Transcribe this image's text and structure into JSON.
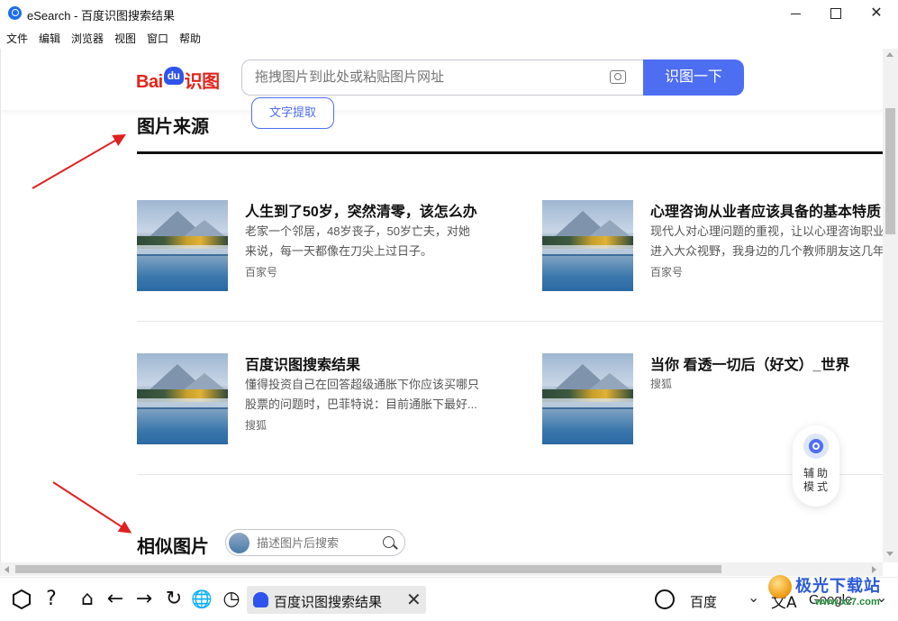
{
  "window": {
    "title": "eSearch - 百度识图搜索结果",
    "minimize": "",
    "maximize": "",
    "close": "✕"
  },
  "menu": [
    "文件",
    "编辑",
    "浏览器",
    "视图",
    "窗口",
    "帮助"
  ],
  "header": {
    "logo_bai": "Bai",
    "logo_du": "du",
    "logo_shi": "识图",
    "search_placeholder": "拖拽图片到此处或粘贴图片网址",
    "search_button": "识图一下",
    "text_extract": "文字提取"
  },
  "sections": {
    "image_source": "图片来源",
    "similar_images": "相似图片"
  },
  "results": [
    {
      "title": "人生到了50岁，突然清零，该怎么办",
      "desc1": "老家一个邻居，48岁丧子，50岁亡夫，对她",
      "desc2": "来说，每一天都像在刀尖上过日子。",
      "source": "百家号"
    },
    {
      "title": "心理咨询从业者应该具备的基本特质",
      "desc1": "现代人对心理问题的重视，让以心理咨询职业",
      "desc2": "进入大众视野，我身边的几个教师朋友这几年",
      "source": "百家号"
    },
    {
      "title": "百度识图搜索结果",
      "desc1": "懂得投资自己在回答超级通胀下你应该买哪只",
      "desc2": "股票的问题时，巴菲特说：目前通胀下最好...",
      "source": "搜狐"
    },
    {
      "title": "当你 看透一切后（好文）_世界",
      "source": "搜狐"
    }
  ],
  "assist": {
    "label": "辅助模式"
  },
  "similar_search": {
    "placeholder": "描述图片后搜索"
  },
  "toolbar": {
    "help_icon": "?",
    "home_icon": "⌂",
    "back_icon": "←",
    "forward_icon": "→",
    "reload_icon": "↻",
    "globe_icon": "🌐",
    "history_icon": "◷",
    "tab_title": "百度识图搜索结果",
    "tab_close": "✕",
    "search_engine": "百度",
    "engine_chevron": "⌄",
    "translate_icon": "文A",
    "translate_engine": "Google",
    "translate_chevron": "⌄"
  },
  "watermark": {
    "text": "极光下载站",
    "url": "www.xz7.com"
  },
  "colors": {
    "accent": "#4e6ef2",
    "baidu_red": "#e1251b",
    "baidu_blue": "#2f54eb",
    "annotation_arrow": "#e02020"
  }
}
